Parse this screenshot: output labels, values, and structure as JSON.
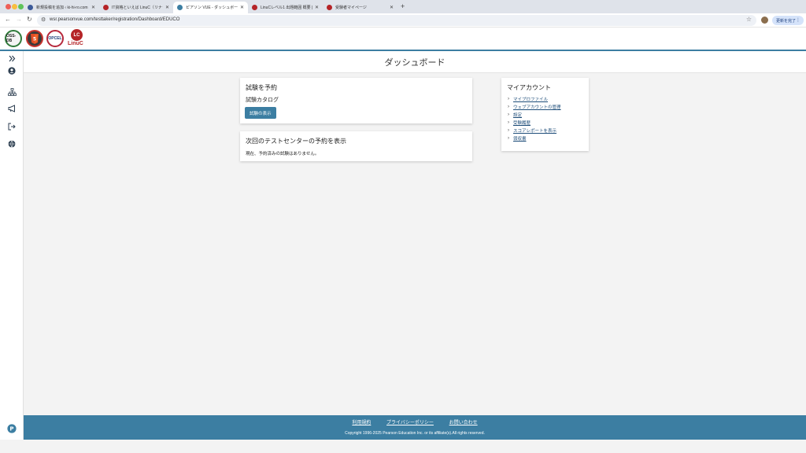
{
  "browser": {
    "tabs": [
      {
        "label": "新規投稿を追加 ‹ ki-hi-ro.com",
        "active": false,
        "favicon_color": "#3b5998"
      },
      {
        "label": "IT資格といえば LinuC（リナック",
        "active": false,
        "favicon_color": "#b52427"
      },
      {
        "label": "ピアソン VUE - ダッシュボード",
        "active": true,
        "favicon_color": "#3c7ea2"
      },
      {
        "label": "LinuCレベル1 出題範囲 概要 | L",
        "active": false,
        "favicon_color": "#b52427"
      },
      {
        "label": "受験者マイページ",
        "active": false,
        "favicon_color": "#b52427"
      }
    ],
    "url": "wsr.pearsonvue.com/testtaker/registration/Dashboard/EDUCO",
    "update_button": "更新を完了"
  },
  "logos": {
    "oss": "OSS-DB",
    "opcel": "OPCEL",
    "linuc_mark": "LC",
    "linuc_word": "LinuC"
  },
  "page": {
    "title": "ダッシュボード"
  },
  "exam_card": {
    "heading": "試験を予約",
    "catalog_label": "試験カタログ",
    "view_button": "試験の表示"
  },
  "next_card": {
    "heading": "次回のテストセンターの予約を表示",
    "message": "現在、予約済みの試験はありません。"
  },
  "account_card": {
    "heading": "マイアカウント",
    "links": [
      "マイプロファイル",
      "ウェブアカウントの管理",
      "設定",
      "受験履歴",
      "スコアレポートを表示",
      "領収書"
    ]
  },
  "footer": {
    "links": [
      "利用規約",
      "プライバシーポリシー",
      "お問い合わせ"
    ],
    "copyright": "Copyright 1996-2025 Pearson Education Inc. or its affiliate(s).All rights reserved."
  },
  "colors": {
    "brand": "#3c7ea2",
    "linuc_red": "#b52427"
  },
  "icons": {
    "sidebar": [
      "expand-chevrons-icon",
      "user-account-icon",
      "sitemap-icon",
      "megaphone-icon",
      "logout-icon",
      "globe-icon"
    ],
    "help": "pearson-logo-icon"
  }
}
